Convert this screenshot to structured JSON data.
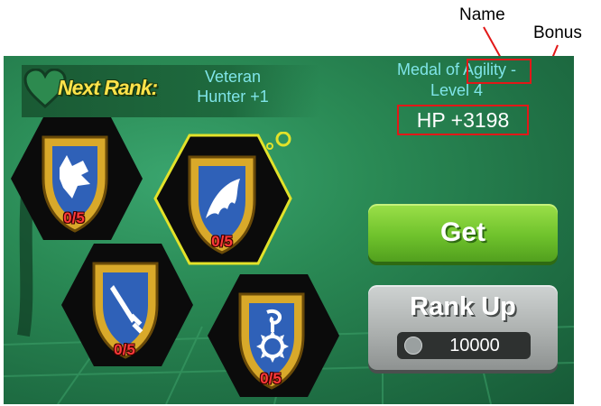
{
  "annotations": {
    "name_label": "Name",
    "bonus_label": "Bonus"
  },
  "rank": {
    "next_rank_label": "Next Rank:",
    "rank_name": "Veteran\nHunter +1"
  },
  "medal_info": {
    "title_prefix": "Medal of ",
    "title_name": "Agility",
    "title_suffix": " -",
    "level": "Level 4",
    "bonus": "HP +3198"
  },
  "buttons": {
    "get_label": "Get",
    "rank_up_label": "Rank Up",
    "rank_up_cost": "10000"
  },
  "medals": [
    {
      "name": "Wolf",
      "icon": "wolf-icon",
      "progress": "0/5"
    },
    {
      "name": "Agility",
      "icon": "wing-icon",
      "progress": "0/5",
      "selected": true
    },
    {
      "name": "Dagger",
      "icon": "dagger-icon",
      "progress": "0/5"
    },
    {
      "name": "Sun",
      "icon": "sun-icon",
      "progress": "0/5"
    }
  ],
  "colors": {
    "accent_text": "#7fe4e8",
    "highlight_red": "#e21818",
    "rank_yellow": "#ffe34a",
    "get_green": "#6fc22c"
  }
}
